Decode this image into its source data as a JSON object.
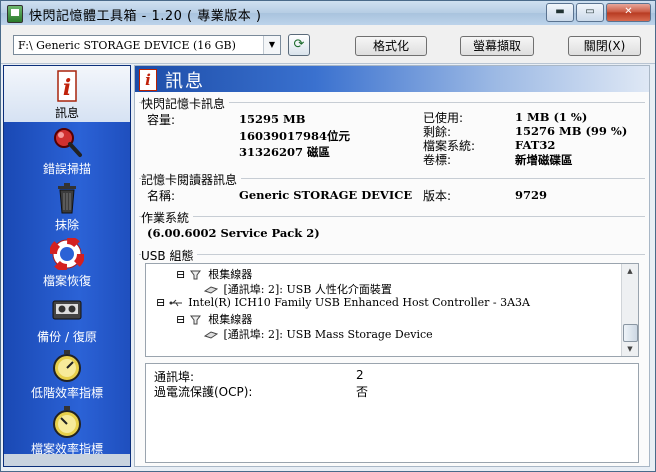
{
  "window": {
    "title": "快閃記憶體工具箱 - 1.20 ( 專業版本 )",
    "buttons": {
      "minimize": "▬",
      "maximize": "▭",
      "close": "✕"
    }
  },
  "toolbar": {
    "device_selected": "F:\\ Generic STORAGE DEVICE (16 GB)",
    "refresh_icon": "refresh-icon",
    "format_label": "格式化",
    "capture_label": "螢幕擷取",
    "close_label": "關閉(X)"
  },
  "sidebar": {
    "items": [
      {
        "label": "訊息",
        "icon": "info-icon",
        "active": true
      },
      {
        "label": "錯誤掃描",
        "icon": "magnifier-icon",
        "active": false
      },
      {
        "label": "抹除",
        "icon": "trash-icon",
        "active": false
      },
      {
        "label": "檔案恢復",
        "icon": "lifebuoy-icon",
        "active": false
      },
      {
        "label": "備份 / 復原",
        "icon": "tape-icon",
        "active": false
      },
      {
        "label": "低階效率指標",
        "icon": "stopwatch-icon",
        "active": false
      },
      {
        "label": "檔案效率指標",
        "icon": "stopwatch-icon",
        "active": false
      }
    ]
  },
  "main": {
    "header_title": "訊息",
    "flash_info": {
      "title": "快閃記憶卡訊息",
      "capacity_label": "容量:",
      "capacity_mb": "15295 MB",
      "capacity_bytes": "16039017984位元",
      "capacity_sectors": "31326207 磁區",
      "used_label": "已使用:",
      "used_value": "1 MB (1 %)",
      "free_label": "剩餘:",
      "free_value": "15276 MB (99 %)",
      "fs_label": "檔案系統:",
      "fs_value": "FAT32",
      "vol_label": "卷標:",
      "vol_value": "新增磁碟區"
    },
    "reader_info": {
      "title": "記憶卡閱讀器訊息",
      "name_label": "名稱:",
      "name_value": "Generic STORAGE DEVICE",
      "version_label": "版本:",
      "version_value": "9729"
    },
    "os": {
      "title": "作業系統",
      "value": "(6.00.6002 Service Pack 2)"
    },
    "usb": {
      "title": "USB 組態",
      "tree": [
        "根集線器",
        "[通訊埠: 2]: USB 人性化介面裝置",
        "Intel(R) ICH10 Family USB Enhanced Host Controller - 3A3A",
        "根集線器",
        "[通訊埠: 2]: USB Mass Storage Device"
      ]
    },
    "details": {
      "port_label": "通訊埠:",
      "port_value": "2",
      "ocp_label": "過電流保護(OCP):",
      "ocp_value": "否"
    }
  }
}
